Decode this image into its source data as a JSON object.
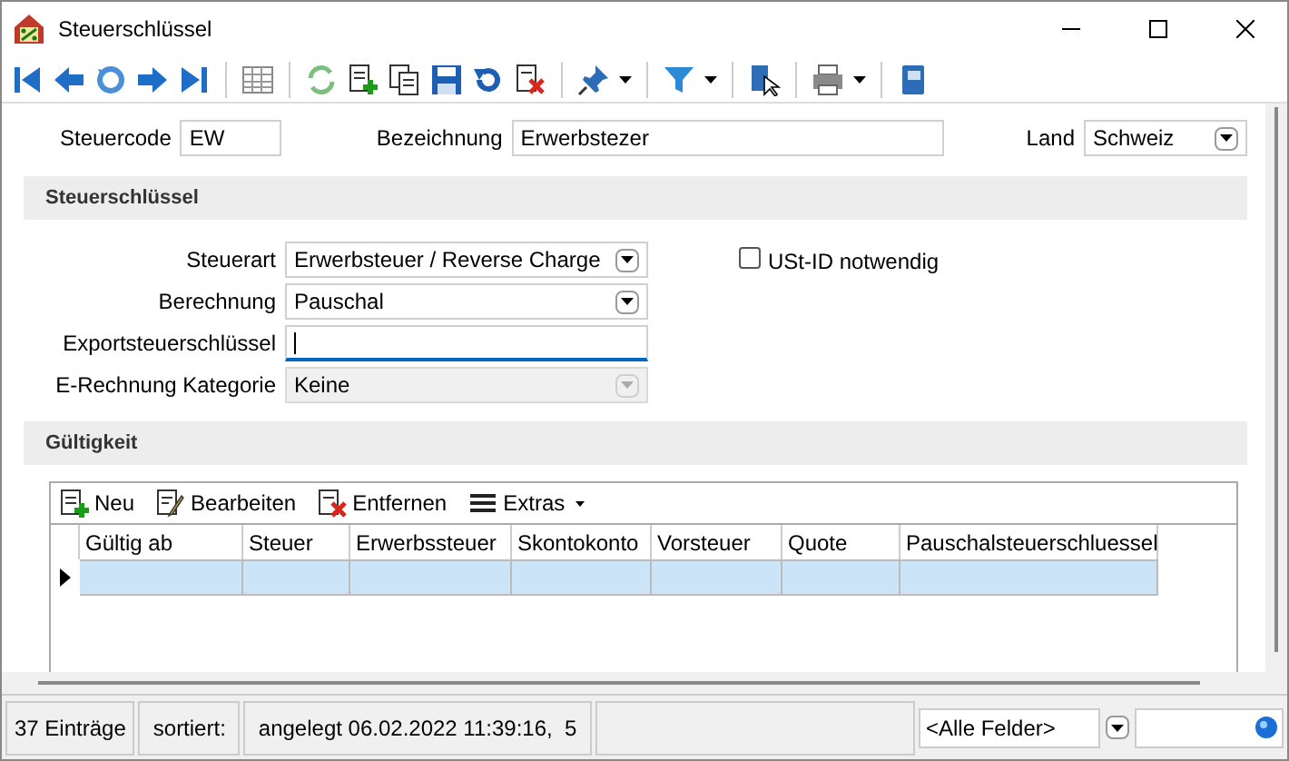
{
  "window": {
    "title": "Steuerschlüssel"
  },
  "header": [
    {
      "kind": "text",
      "label": "Steuercode",
      "value": "EW"
    },
    {
      "kind": "text",
      "label": "Bezeichnung",
      "value": "Erwerbstezer"
    },
    {
      "kind": "dropdown",
      "label": "Land",
      "value": "Schweiz"
    }
  ],
  "sections": [
    {
      "title": "Steuerschlüssel"
    },
    {
      "title": "Gültigkeit"
    }
  ],
  "fields": [
    {
      "kind": "dropdown",
      "label": "Steuerart",
      "value": "Erwerbsteuer / Reverse Charge",
      "disabled": false,
      "focused": false
    },
    {
      "kind": "dropdown",
      "label": "Berechnung",
      "value": "Pauschal",
      "disabled": false,
      "focused": false
    },
    {
      "kind": "text",
      "label": "Exportsteuerschlüssel",
      "disabled": false,
      "focused": true
    },
    {
      "kind": "dropdown",
      "label": "E-Rechnung Kategorie",
      "value": "Keine",
      "disabled": true,
      "focused": false
    }
  ],
  "checkbox": {
    "label": "USt-ID notwendig",
    "checked": false
  },
  "grid_toolbar": [
    {
      "kind": "add",
      "label": "Neu"
    },
    {
      "kind": "edit",
      "label": "Bearbeiten"
    },
    {
      "kind": "delete",
      "label": "Entfernen"
    },
    {
      "kind": "menu",
      "label": "Extras"
    }
  ],
  "table": {
    "columns": [
      "Gültig ab",
      "Steuer",
      "Erwerbssteuer",
      "Skontokonto",
      "Vorsteuer",
      "Quote",
      "Pauschalsteuerschluessel"
    ],
    "rows": [
      {
        "selected": true
      }
    ]
  },
  "status_bar": {
    "count": "37 Einträge",
    "sorted": "sortiert:",
    "created": "angelegt 06.02.2022 11:39:16,  5",
    "filter": "<Alle Felder>"
  }
}
